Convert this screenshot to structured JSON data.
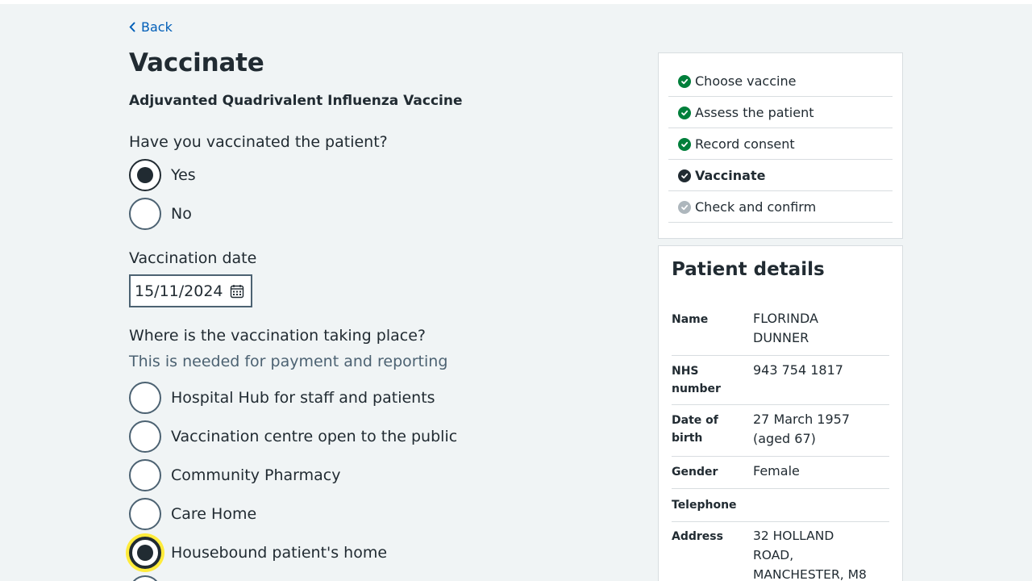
{
  "nav": {
    "back_label": "Back"
  },
  "page": {
    "title": "Vaccinate",
    "vaccine_name": "Adjuvanted Quadrivalent Influenza Vaccine"
  },
  "vaccinated_question": {
    "legend": "Have you vaccinated the patient?",
    "options": [
      {
        "label": "Yes",
        "selected": true
      },
      {
        "label": "No",
        "selected": false
      }
    ]
  },
  "vaccination_date": {
    "label": "Vaccination date",
    "value": "15/11/2024",
    "icon": "calendar-icon"
  },
  "location_question": {
    "legend": "Where is the vaccination taking place?",
    "hint": "This is needed for payment and reporting",
    "options": [
      {
        "label": "Hospital Hub for staff and patients",
        "selected": false
      },
      {
        "label": "Vaccination centre open to the public",
        "selected": false
      },
      {
        "label": "Community Pharmacy",
        "selected": false
      },
      {
        "label": "Care Home",
        "selected": false
      },
      {
        "label": "Housebound patient's home",
        "selected": true
      }
    ]
  },
  "steps": [
    {
      "label": "Choose vaccine",
      "status": "done"
    },
    {
      "label": "Assess the patient",
      "status": "done"
    },
    {
      "label": "Record consent",
      "status": "done"
    },
    {
      "label": "Vaccinate",
      "status": "current"
    },
    {
      "label": "Check and confirm",
      "status": "todo"
    }
  ],
  "patient": {
    "title": "Patient details",
    "name_key": "Name",
    "name_value": "FLORINDA DUNNER",
    "nhs_key": "NHS number",
    "nhs_value": "943 754 1817",
    "dob_key": "Date of birth",
    "dob_value": "27 March 1957 (aged 67)",
    "gender_key": "Gender",
    "gender_value": "Female",
    "phone_key": "Telephone",
    "phone_value": "",
    "address_key": "Address",
    "address_value": "32 HOLLAND ROAD, MANCHESTER, M8"
  },
  "colors": {
    "background": "#f0f4f5",
    "link": "#005eb8",
    "done": "#007f3b",
    "focus": "#ffeb3b"
  }
}
